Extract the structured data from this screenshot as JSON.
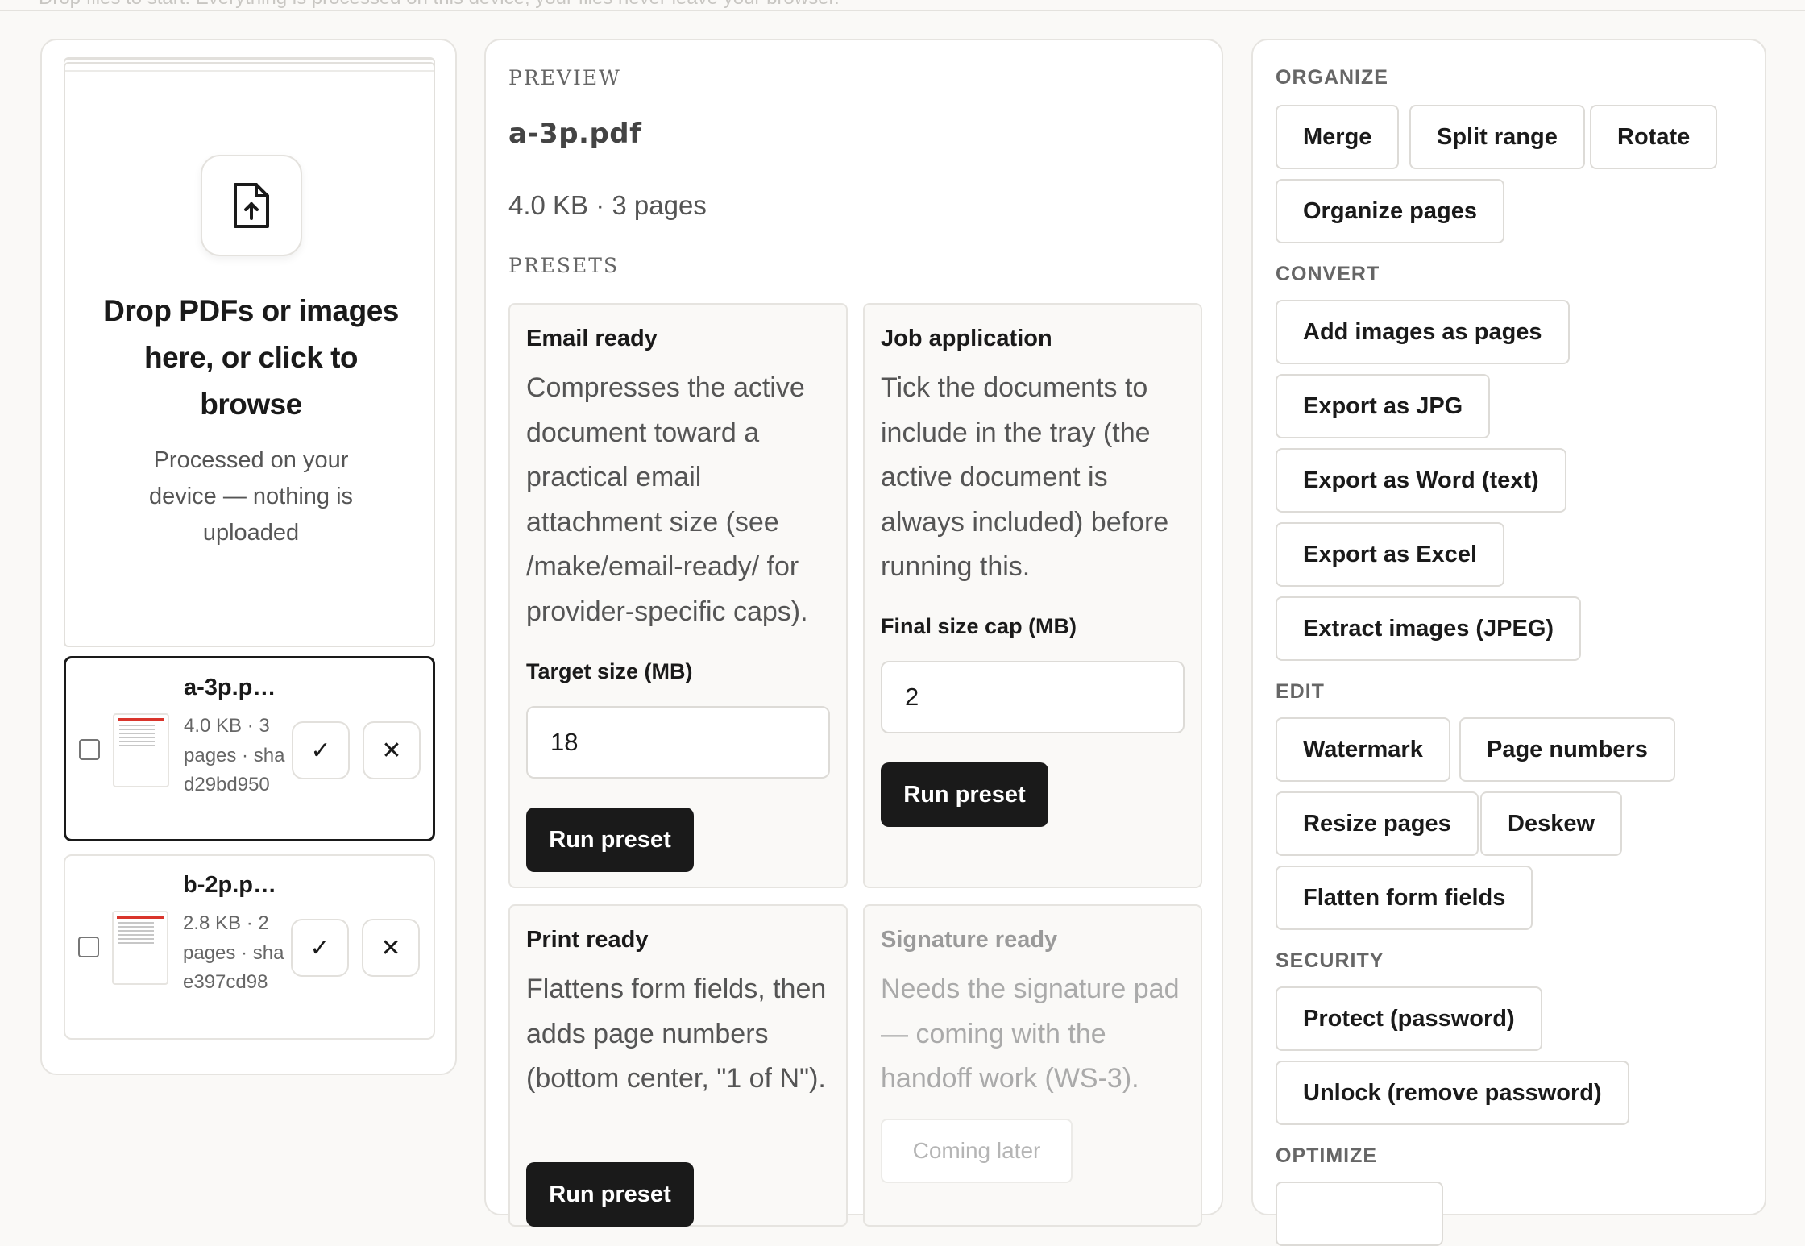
{
  "header": {
    "text": "Drop files to start. Everything is processed on this device; your files never leave your browser."
  },
  "dropzone": {
    "icon": "file-upload-icon",
    "title": "Drop PDFs or images here, or click to browse",
    "subtitle": "Processed on your device — nothing is uploaded"
  },
  "files": [
    {
      "name": "a-3p.p…",
      "meta": "4.0 KB · 3 pages · sha d29bd950",
      "active": true
    },
    {
      "name": "b-2p.p…",
      "meta": "2.8 KB · 2 pages · sha e397cd98",
      "active": false
    }
  ],
  "preview": {
    "label": "PREVIEW",
    "filename": "a-3p.pdf",
    "meta": "4.0 KB · 3 pages"
  },
  "presets": {
    "label": "PRESETS",
    "email": {
      "title": "Email ready",
      "description": "Compresses the active document toward a practical email attachment size (see /make/email-ready/ for provider-specific caps).",
      "field_label": "Target size (MB)",
      "field_value": "18",
      "button": "Run preset"
    },
    "job": {
      "title": "Job application",
      "description": "Tick the documents to include in the tray (the active document is always included) before running this.",
      "field_label": "Final size cap (MB)",
      "field_value": "2",
      "button": "Run preset"
    },
    "print": {
      "title": "Print ready",
      "description": "Flattens form fields, then adds page numbers (bottom center, \"1 of N\").",
      "button": "Run preset"
    },
    "signature": {
      "title": "Signature ready",
      "description": "Needs the signature pad — coming with the handoff work (WS-3).",
      "button": "Coming later",
      "disabled": true
    }
  },
  "tools": {
    "organize": {
      "label": "ORGANIZE",
      "items": [
        "Merge",
        "Split range",
        "Rotate",
        "Organize pages"
      ]
    },
    "convert": {
      "label": "CONVERT",
      "items": [
        "Add images as pages",
        "Export as JPG",
        "Export as Word (text)",
        "Export as Excel",
        "Extract images (JPEG)"
      ]
    },
    "edit": {
      "label": "EDIT",
      "items": [
        "Watermark",
        "Page numbers",
        "Resize pages",
        "Deskew",
        "Flatten form fields"
      ]
    },
    "security": {
      "label": "SECURITY",
      "items": [
        "Protect (password)",
        "Unlock (remove password)"
      ]
    },
    "optimize": {
      "label": "OPTIMIZE",
      "items": [
        ""
      ]
    }
  },
  "colors": {
    "primary_button": "#1a1a1a",
    "panel_border": "#e6e4e0",
    "background": "#faf9f7"
  }
}
